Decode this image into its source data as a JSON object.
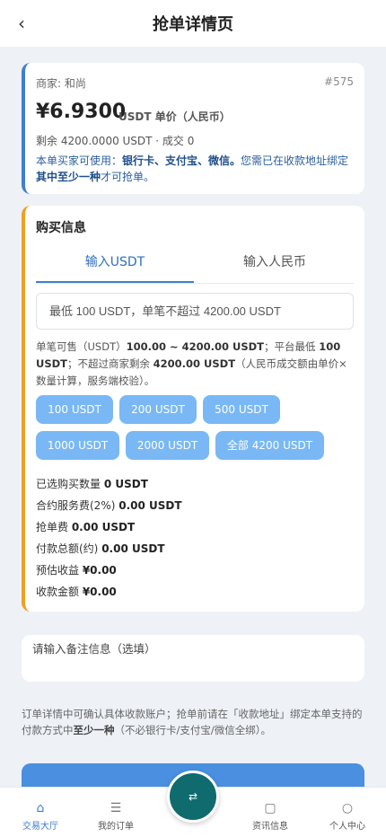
{
  "header": {
    "title": "抢单详情页",
    "back_icon": "‹"
  },
  "order": {
    "merchant": "商家: 和尚",
    "order_no": "#575",
    "price": "¥6.9300",
    "price_unit": "USDT 单价（人民币）",
    "remain": "剩余 4200.0000 USDT · 成交 0",
    "notice_prefix": "本单买家可使用：",
    "notice_methods": "银行卡、支付宝、微信。",
    "notice_mid": "您需已在收款地址绑定",
    "notice_strong": "其中至少一种",
    "notice_suffix": "才可抢单。"
  },
  "buy": {
    "title": "购买信息",
    "tabs": [
      "输入USDT",
      "输入人民币"
    ],
    "input_placeholder": "最低 100 USDT，单笔不超过 4200.00 USDT",
    "hint_a": "单笔可售（USDT）",
    "hint_b": "100.00 ~ 4200.00 USDT",
    "hint_c": "；平台最低 ",
    "hint_d": "100 USDT",
    "hint_e": "；不超过商家剩余 ",
    "hint_f": "4200.00 USDT",
    "hint_g": "（人民币成交额由单价×数量计算，服务端校验）。",
    "chips": [
      "100 USDT",
      "200 USDT",
      "500 USDT",
      "1000 USDT",
      "2000 USDT",
      "全部 4200 USDT"
    ],
    "summary": [
      {
        "label": "已选购买数量 ",
        "value": "0 USDT"
      },
      {
        "label": "合约服务费(2%) ",
        "value": "0.00 USDT"
      },
      {
        "label": "抢单费 ",
        "value": "0.00 USDT"
      },
      {
        "label": "付款总额(约) ",
        "value": "0.00 USDT"
      },
      {
        "label": "预估收益 ",
        "value": "¥0.00"
      },
      {
        "label": "收款金额 ",
        "value": "¥0.00"
      }
    ]
  },
  "remark": {
    "placeholder": "请输入备注信息（选填）"
  },
  "footnote": {
    "text_a": "订单详情中可确认具体收款账户；抢单前请在「收款地址」绑定本单支持的付款方式中",
    "text_b": "至少一种",
    "text_c": "（不必银行卡/支付宝/微信全绑）。"
  },
  "fab": {
    "icon": "⇄"
  },
  "tabbar": [
    {
      "label": "交易大厅",
      "icon": "⌂"
    },
    {
      "label": "我的订单",
      "icon": "☰"
    },
    {
      "label": "资讯信息",
      "icon": "▢"
    },
    {
      "label": "个人中心",
      "icon": "○"
    }
  ]
}
